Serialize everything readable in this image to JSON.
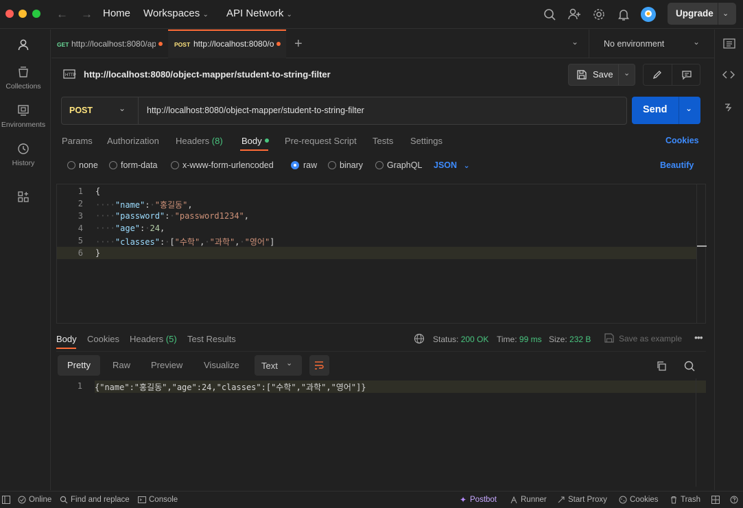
{
  "topnav": {
    "home": "Home",
    "workspaces": "Workspaces",
    "api_network": "API Network",
    "upgrade": "Upgrade"
  },
  "sidebar": {
    "items": [
      {
        "label": "",
        "icon": "user-icon"
      },
      {
        "label": "Collections",
        "icon": "collections-icon"
      },
      {
        "label": "Environments",
        "icon": "environments-icon"
      },
      {
        "label": "History",
        "icon": "history-icon"
      },
      {
        "label": "",
        "icon": "apps-icon"
      }
    ]
  },
  "tabs": [
    {
      "method": "GET",
      "url": "http://localhost:8080/ap",
      "method_color": "#6bdd9a"
    },
    {
      "method": "POST",
      "url": "http://localhost:8080/o",
      "method_color": "#ffe47e"
    }
  ],
  "environment": "No environment",
  "request": {
    "title": "http://localhost:8080/object-mapper/student-to-string-filter",
    "method": "POST",
    "url": "http://localhost:8080/object-mapper/student-to-string-filter",
    "save_label": "Save",
    "send_label": "Send"
  },
  "request_tabs": {
    "params": "Params",
    "authorization": "Authorization",
    "headers": "Headers",
    "headers_count": "(8)",
    "body": "Body",
    "pre_request": "Pre-request Script",
    "tests": "Tests",
    "settings": "Settings",
    "cookies": "Cookies"
  },
  "body_modes": {
    "none": "none",
    "form_data": "form-data",
    "urlencoded": "x-www-form-urlencoded",
    "raw": "raw",
    "binary": "binary",
    "graphql": "GraphQL",
    "format": "JSON",
    "beautify": "Beautify",
    "selected": "raw"
  },
  "editor": {
    "line_numbers": [
      "1",
      "2",
      "3",
      "4",
      "5",
      "6"
    ],
    "line1": "{",
    "l2_key": "\"name\"",
    "l2_val": "\"홍길동\"",
    "l3_key": "\"password\"",
    "l3_val": "\"password1234\"",
    "l4_key": "\"age\"",
    "l4_val": "24",
    "l5_key": "\"classes\"",
    "l5_v1": "\"수학\"",
    "l5_v2": "\"과학\"",
    "l5_v3": "\"영어\"",
    "line6": "}"
  },
  "response": {
    "tabs": {
      "body": "Body",
      "cookies": "Cookies",
      "headers": "Headers",
      "headers_count": "(5)",
      "test_results": "Test Results"
    },
    "status_label": "Status:",
    "status_value": "200 OK",
    "time_label": "Time:",
    "time_value": "99 ms",
    "size_label": "Size:",
    "size_value": "232 B",
    "save_example": "Save as example",
    "views": {
      "pretty": "Pretty",
      "raw": "Raw",
      "preview": "Preview",
      "visualize": "Visualize",
      "format": "Text"
    },
    "line_number": "1",
    "body": "{\"name\":\"홍길동\",\"age\":24,\"classes\":[\"수학\",\"과학\",\"영어\"]}"
  },
  "statusbar": {
    "online": "Online",
    "find_replace": "Find and replace",
    "console": "Console",
    "postbot": "Postbot",
    "runner": "Runner",
    "start_proxy": "Start Proxy",
    "cookies": "Cookies",
    "trash": "Trash"
  },
  "colors": {
    "accent": "#ff6c37",
    "send": "#0f5dd0",
    "link": "#3d8bfd",
    "status_ok": "#49c57f"
  }
}
